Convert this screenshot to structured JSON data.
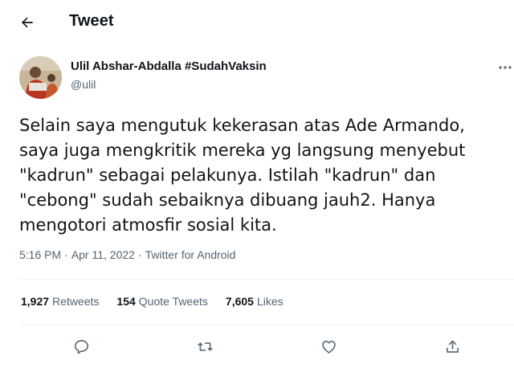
{
  "header": {
    "title": "Tweet",
    "back_icon": "arrow-left-icon"
  },
  "author": {
    "display_name": "Ulil Abshar-Abdalla #SudahVaksin",
    "handle": "@ulil",
    "avatar_icon": "profile-photo",
    "more_icon": "more-horizontal-icon"
  },
  "tweet": {
    "text": "Selain saya mengutuk kekerasan atas Ade Armando,\nsaya juga mengkritik mereka yg langsung menyebut\n\"kadrun\" sebagai pelakunya. Istilah \"kadrun\" dan\n\"cebong\" sudah sebaiknya dibuang jauh2. Hanya\nmengotori atmosfir sosial kita.",
    "time": "5:16 PM",
    "separator1": "·",
    "date": "Apr 11, 2022",
    "separator2": "·",
    "source": "Twitter for Android"
  },
  "stats": {
    "retweets_count": "1,927",
    "retweets_label": "Retweets",
    "quotes_count": "154",
    "quotes_label": "Quote Tweets",
    "likes_count": "7,605",
    "likes_label": "Likes"
  },
  "actions": {
    "reply_icon": "reply-icon",
    "retweet_icon": "retweet-icon",
    "like_icon": "like-icon",
    "share_icon": "share-icon"
  },
  "colors": {
    "text": "#0f1419",
    "secondary": "#536471",
    "divider": "#eff3f4"
  }
}
